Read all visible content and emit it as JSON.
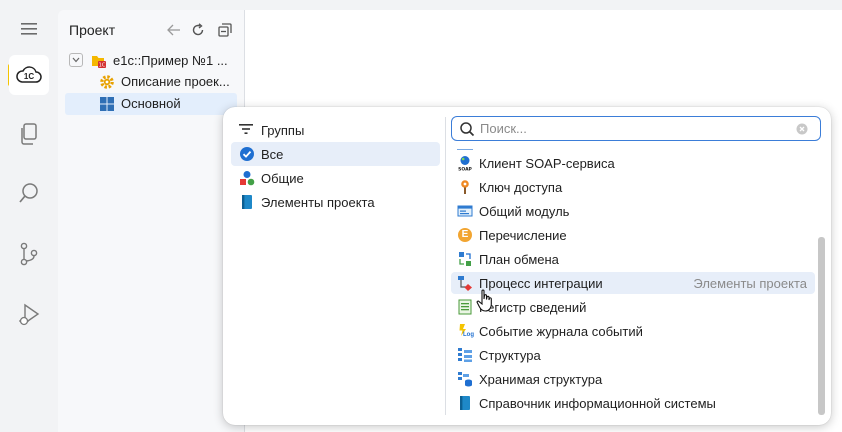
{
  "activity_bar": {
    "items": [
      {
        "name": "menu-icon"
      },
      {
        "name": "1c-cloud-icon",
        "label": "1С",
        "active": true
      },
      {
        "name": "copy-files-icon"
      },
      {
        "name": "search-icon"
      },
      {
        "name": "source-control-icon"
      },
      {
        "name": "run-debug-icon"
      }
    ],
    "accent": "#f4c400"
  },
  "project_panel": {
    "title": "Проект",
    "tree": [
      {
        "label": "е1с::Пример №1 ...",
        "icon": "project-folder-icon",
        "expanded": true
      },
      {
        "label": "Описание проек...",
        "icon": "gear-icon"
      },
      {
        "label": "Основной",
        "icon": "grid-icon",
        "selected": true
      }
    ]
  },
  "popup": {
    "groups": {
      "header": "Группы",
      "items": [
        {
          "label": "Все",
          "icon": "check-circle-icon",
          "selected": true
        },
        {
          "label": "Общие",
          "icon": "shapes-icon"
        },
        {
          "label": "Элементы проекта",
          "icon": "book-icon"
        }
      ]
    },
    "search": {
      "placeholder": "Поиск...",
      "value": ""
    },
    "items": [
      {
        "label": "Клиент SOAP-сервиса",
        "icon": "soap-icon"
      },
      {
        "label": "Ключ доступа",
        "icon": "key-pin-icon"
      },
      {
        "label": "Общий модуль",
        "icon": "module-icon"
      },
      {
        "label": "Перечисление",
        "icon": "enum-icon",
        "badge": "E"
      },
      {
        "label": "План обмена",
        "icon": "exchange-plan-icon"
      },
      {
        "label": "Процесс интеграции",
        "icon": "integration-process-icon",
        "category": "Элементы проекта",
        "hover": true
      },
      {
        "label": "Регистр сведений",
        "icon": "info-register-icon"
      },
      {
        "label": "Событие журнала событий",
        "icon": "log-event-icon",
        "badge": "Log"
      },
      {
        "label": "Структура",
        "icon": "structure-icon"
      },
      {
        "label": "Хранимая структура",
        "icon": "stored-structure-icon"
      },
      {
        "label": "Справочник информационной системы",
        "icon": "catalog-icon"
      }
    ]
  }
}
